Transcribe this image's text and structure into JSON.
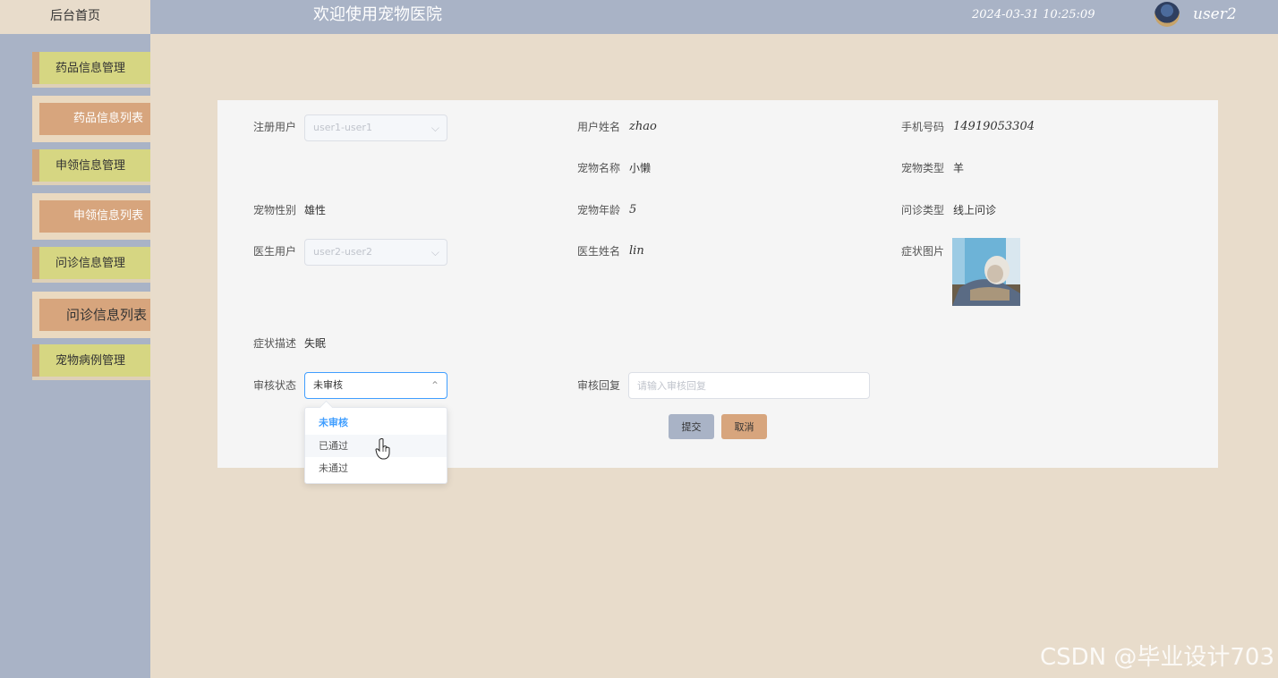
{
  "header": {
    "home_label": "后台首页",
    "title": "欢迎使用宠物医院",
    "datetime": "2024-03-31 10:25:09",
    "username": "user2"
  },
  "sidebar": {
    "items": [
      {
        "label": "药品信息管理",
        "type": "main"
      },
      {
        "label": "药品信息列表",
        "type": "sub"
      },
      {
        "label": "申领信息管理",
        "type": "main"
      },
      {
        "label": "申领信息列表",
        "type": "sub"
      },
      {
        "label": "问诊信息管理",
        "type": "main"
      },
      {
        "label": "问诊信息列表",
        "type": "sub",
        "active": true
      },
      {
        "label": "宠物病例管理",
        "type": "main"
      }
    ]
  },
  "form": {
    "registered_user": {
      "label": "注册用户",
      "value": "user1-user1"
    },
    "user_name": {
      "label": "用户姓名",
      "value": "zhao"
    },
    "phone": {
      "label": "手机号码",
      "value": "14919053304"
    },
    "pet_name": {
      "label": "宠物名称",
      "value": "小懒"
    },
    "pet_type": {
      "label": "宠物类型",
      "value": "羊"
    },
    "pet_gender": {
      "label": "宠物性别",
      "value": "雄性"
    },
    "pet_age": {
      "label": "宠物年龄",
      "value": "5"
    },
    "consult_type": {
      "label": "问诊类型",
      "value": "线上问诊"
    },
    "doctor_user": {
      "label": "医生用户",
      "value": "user2-user2"
    },
    "doctor_name": {
      "label": "医生姓名",
      "value": "lin"
    },
    "symptom_image": {
      "label": "症状图片"
    },
    "symptom_desc": {
      "label": "症状描述",
      "value": "失眠"
    },
    "review_status": {
      "label": "审核状态",
      "value": "未审核",
      "options": [
        "未审核",
        "已通过",
        "未通过"
      ]
    },
    "review_reply": {
      "label": "审核回复",
      "placeholder": "请输入审核回复"
    },
    "submit_label": "提交",
    "cancel_label": "取消"
  },
  "colors": {
    "sidebar_bg": "#a9b3c6",
    "page_bg": "#e8dccb",
    "menu_main": "#d6d682",
    "menu_sub": "#d7a57d",
    "accent": "#409eff"
  },
  "watermark": "CSDN @毕业设计703"
}
